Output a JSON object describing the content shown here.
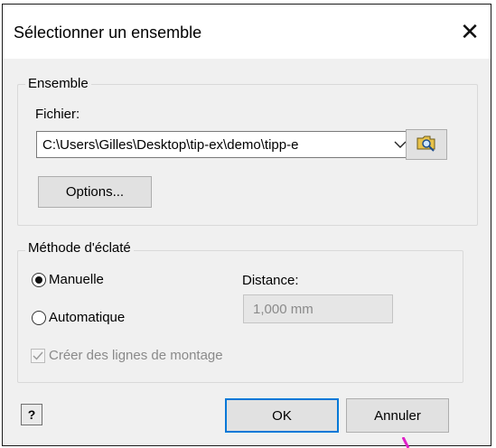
{
  "dialog": {
    "title": "Sélectionner un ensemble",
    "close_glyph": "✕"
  },
  "ensemble_group": {
    "legend": "Ensemble",
    "file_label": "Fichier:",
    "file_value": "C:\\Users\\Gilles\\Desktop\\tip-ex\\demo\\tipp-e",
    "browse_icon": "folder-search-icon",
    "options_label": "Options..."
  },
  "explode_group": {
    "legend": "Méthode d'éclaté",
    "manual_label": "Manuelle",
    "manual_checked": true,
    "auto_label": "Automatique",
    "auto_checked": false,
    "distance_label": "Distance:",
    "distance_value": "1,000 mm",
    "lines_label": "Créer des lignes de montage",
    "lines_checked": true,
    "lines_disabled": true
  },
  "footer": {
    "help_glyph": "?",
    "ok_label": "OK",
    "cancel_label": "Annuler"
  },
  "colors": {
    "focus_border": "#0078d7",
    "marker": "#e020c8"
  }
}
